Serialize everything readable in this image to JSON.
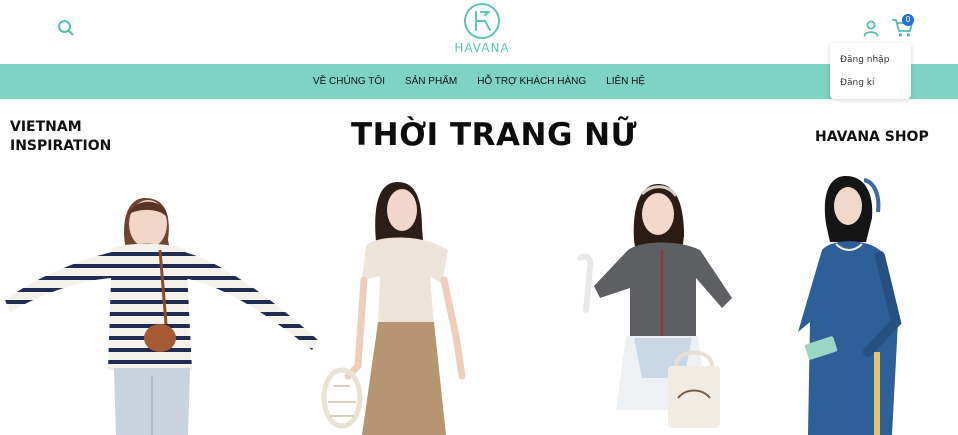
{
  "header": {
    "logo_text": "HAVANA",
    "cart_count": "0"
  },
  "nav": {
    "items": [
      "VỀ CHÚNG TÔI",
      "SẢN PHẨM",
      "HỖ TRỢ KHÁCH HÀNG",
      "LIÊN HỆ"
    ]
  },
  "account_menu": {
    "login": "Đăng nhập",
    "register": "Đăng kí"
  },
  "hero": {
    "left_line1": "VIETNAM",
    "left_line2": "INSPIRATION",
    "title": "THỜI TRANG NỮ",
    "right_text": "HAVANA SHOP"
  },
  "colors": {
    "accent": "#7ed3c3",
    "logo": "#58c6b4",
    "icon": "#4fbfae",
    "badge": "#1f6fe0"
  },
  "icons": [
    "search-icon",
    "user-icon",
    "cart-icon"
  ]
}
